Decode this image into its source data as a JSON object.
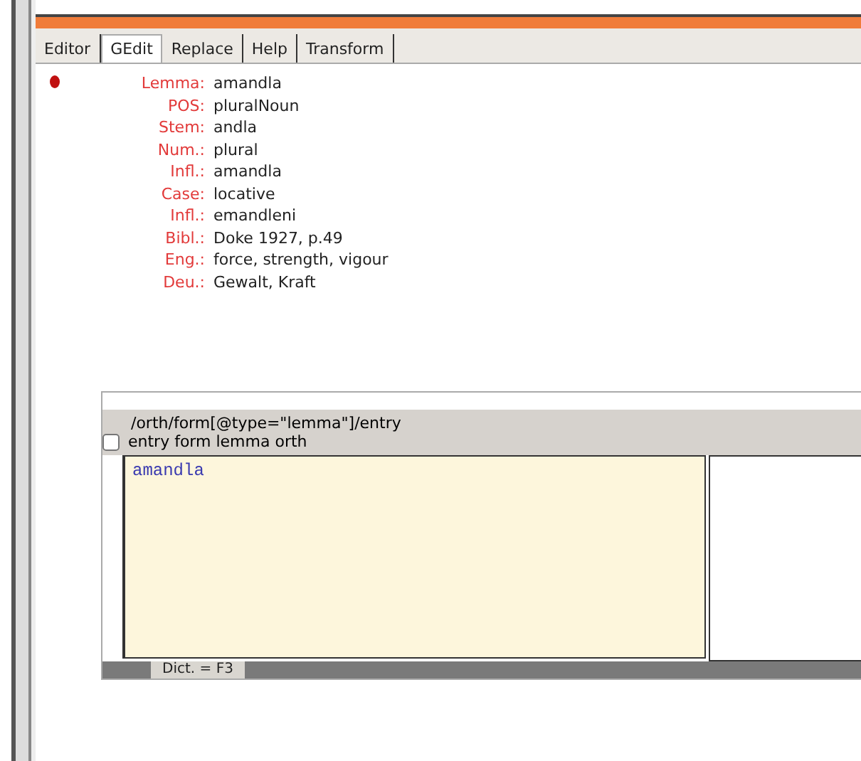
{
  "tabs": [
    {
      "label": "Editor",
      "selected": false
    },
    {
      "label": "GEdit",
      "selected": true
    },
    {
      "label": "Replace",
      "selected": false
    },
    {
      "label": "Help",
      "selected": false
    },
    {
      "label": "Transform",
      "selected": false
    }
  ],
  "fields": [
    {
      "label": "Lemma:",
      "value": "amandla"
    },
    {
      "label": "POS:",
      "value": "pluralNoun"
    },
    {
      "label": "Stem:",
      "value": "andla"
    },
    {
      "label": "Num.:",
      "value": "plural"
    },
    {
      "label": "Infl.:",
      "value": "amandla"
    },
    {
      "label": "Case:",
      "value": "locative"
    },
    {
      "label": "Infl.:",
      "value": "emandleni"
    },
    {
      "label": "Bibl.:",
      "value": "Doke 1927, p.49"
    },
    {
      "label": "Eng.:",
      "value": "force, strength, vigour"
    },
    {
      "label": "Deu.:",
      "value": "Gewalt, Kraft"
    }
  ],
  "subpanel": {
    "xpath": "/orth/form[@type=\"lemma\"]/entry",
    "option": {
      "label": "entry form lemma orth",
      "checked": false
    },
    "editor_value": "amandla",
    "status": "Dict. = F3"
  }
}
